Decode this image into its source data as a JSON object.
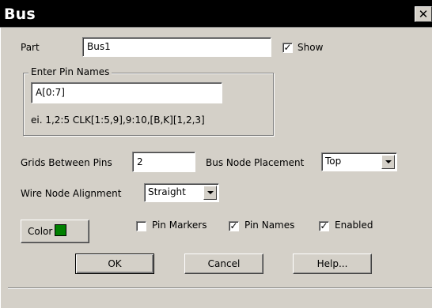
{
  "window": {
    "title": "Bus",
    "close_glyph": "✕"
  },
  "part": {
    "label": "Part",
    "value": "Bus1"
  },
  "show": {
    "label": "Show",
    "checked": true
  },
  "pin_names_group": {
    "label": "Enter Pin Names",
    "value": "A[0:7]",
    "example": "ei. 1,2:5 CLK[1:5,9],9:10,[B,K][1,2,3]"
  },
  "grids_between_pins": {
    "label": "Grids Between Pins",
    "value": "2"
  },
  "bus_node_placement": {
    "label": "Bus Node Placement",
    "selected": "Top"
  },
  "wire_node_alignment": {
    "label": "Wire Node Alignment",
    "selected": "Straight"
  },
  "color": {
    "label": "Color",
    "value": "#008000"
  },
  "options": {
    "pin_markers": {
      "label": "Pin Markers",
      "checked": false
    },
    "pin_names": {
      "label": "Pin Names",
      "checked": true
    },
    "enabled": {
      "label": "Enabled",
      "checked": true
    }
  },
  "buttons": {
    "ok": "OK",
    "cancel": "Cancel",
    "help": "Help..."
  }
}
